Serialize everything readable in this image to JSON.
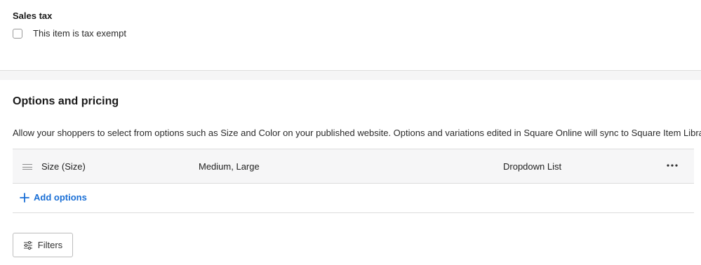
{
  "sales_tax": {
    "title": "Sales tax",
    "exempt_label": "This item is tax exempt",
    "exempt_checked": false
  },
  "options": {
    "title": "Options and pricing",
    "description": "Allow your shoppers to select from options such as Size and Color on your published website. Options and variations edited in Square Online will sync to Square Item Library.",
    "rows": [
      {
        "name": "Size (Size)",
        "values": "Medium, Large",
        "type": "Dropdown List"
      }
    ],
    "add_label": "Add options"
  },
  "filters": {
    "label": "Filters"
  },
  "icons": {
    "drag": "drag-handle-icon",
    "more": "more-horizontal-icon",
    "add": "plus-icon",
    "filters": "sliders-icon"
  },
  "colors": {
    "accent": "#1a6fd6",
    "band": "#f5f5f6",
    "row_bg": "#f6f6f7"
  }
}
